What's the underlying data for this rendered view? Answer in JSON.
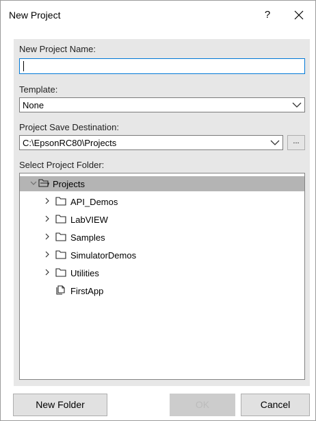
{
  "window": {
    "title": "New Project",
    "help": "?"
  },
  "form": {
    "name_label": "New Project Name:",
    "name_value": "",
    "template_label": "Template:",
    "template_value": "None",
    "destination_label": "Project Save Destination:",
    "destination_value": "C:\\EpsonRC80\\Projects",
    "browse_label": "...",
    "folder_label": "Select Project Folder:"
  },
  "tree": {
    "root": {
      "label": "Projects",
      "expanded": true,
      "selected": true
    },
    "items": [
      {
        "label": "API_Demos",
        "type": "folder"
      },
      {
        "label": "LabVIEW",
        "type": "folder"
      },
      {
        "label": "Samples",
        "type": "folder"
      },
      {
        "label": "SimulatorDemos",
        "type": "folder"
      },
      {
        "label": "Utilities",
        "type": "folder"
      },
      {
        "label": "FirstApp",
        "type": "project"
      }
    ]
  },
  "buttons": {
    "new_folder": "New Folder",
    "ok": "OK",
    "cancel": "Cancel"
  },
  "colors": {
    "selection": "#b4b4b4",
    "focus_border": "#0078d7",
    "panel": "#e7e7e7"
  }
}
